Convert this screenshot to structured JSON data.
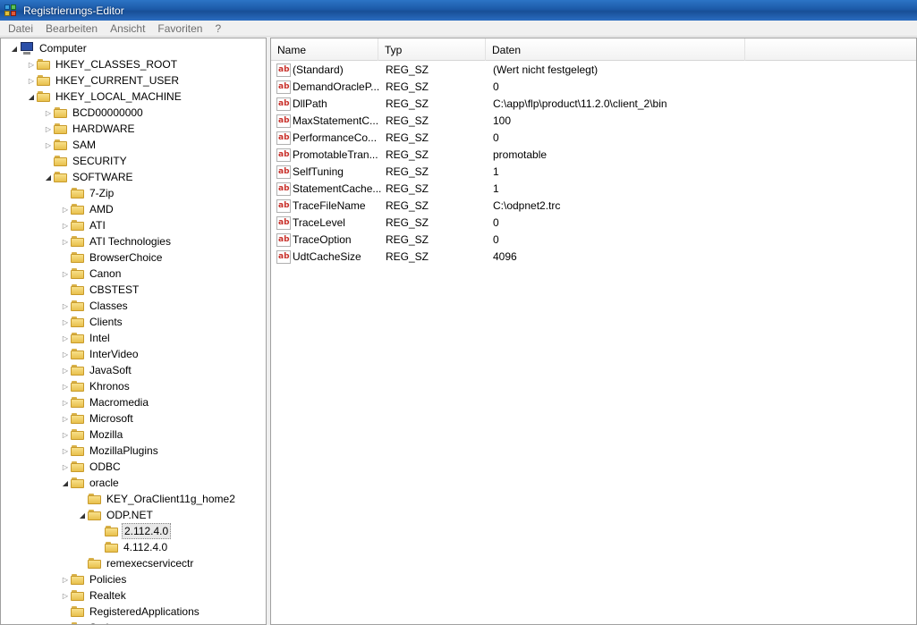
{
  "window": {
    "title": "Registrierungs-Editor"
  },
  "menu": [
    "Datei",
    "Bearbeiten",
    "Ansicht",
    "Favoriten",
    "?"
  ],
  "tree": [
    {
      "label": "Computer",
      "level": 0,
      "state": "open",
      "icon": "computer-icon"
    },
    {
      "label": "HKEY_CLASSES_ROOT",
      "level": 1,
      "state": "closed"
    },
    {
      "label": "HKEY_CURRENT_USER",
      "level": 1,
      "state": "closed"
    },
    {
      "label": "HKEY_LOCAL_MACHINE",
      "level": 1,
      "state": "open"
    },
    {
      "label": "BCD00000000",
      "level": 2,
      "state": "closed"
    },
    {
      "label": "HARDWARE",
      "level": 2,
      "state": "closed"
    },
    {
      "label": "SAM",
      "level": 2,
      "state": "closed"
    },
    {
      "label": "SECURITY",
      "level": 2,
      "state": "none"
    },
    {
      "label": "SOFTWARE",
      "level": 2,
      "state": "open"
    },
    {
      "label": "7-Zip",
      "level": 3,
      "state": "none"
    },
    {
      "label": "AMD",
      "level": 3,
      "state": "closed"
    },
    {
      "label": "ATI",
      "level": 3,
      "state": "closed"
    },
    {
      "label": "ATI Technologies",
      "level": 3,
      "state": "closed"
    },
    {
      "label": "BrowserChoice",
      "level": 3,
      "state": "none"
    },
    {
      "label": "Canon",
      "level": 3,
      "state": "closed"
    },
    {
      "label": "CBSTEST",
      "level": 3,
      "state": "none"
    },
    {
      "label": "Classes",
      "level": 3,
      "state": "closed"
    },
    {
      "label": "Clients",
      "level": 3,
      "state": "closed"
    },
    {
      "label": "Intel",
      "level": 3,
      "state": "closed"
    },
    {
      "label": "InterVideo",
      "level": 3,
      "state": "closed"
    },
    {
      "label": "JavaSoft",
      "level": 3,
      "state": "closed"
    },
    {
      "label": "Khronos",
      "level": 3,
      "state": "closed"
    },
    {
      "label": "Macromedia",
      "level": 3,
      "state": "closed"
    },
    {
      "label": "Microsoft",
      "level": 3,
      "state": "closed"
    },
    {
      "label": "Mozilla",
      "level": 3,
      "state": "closed"
    },
    {
      "label": "MozillaPlugins",
      "level": 3,
      "state": "closed"
    },
    {
      "label": "ODBC",
      "level": 3,
      "state": "closed"
    },
    {
      "label": "oracle",
      "level": 3,
      "state": "open"
    },
    {
      "label": "KEY_OraClient11g_home2",
      "level": 4,
      "state": "none"
    },
    {
      "label": "ODP.NET",
      "level": 4,
      "state": "open"
    },
    {
      "label": "2.112.4.0",
      "level": 5,
      "state": "none",
      "selected": true
    },
    {
      "label": "4.112.4.0",
      "level": 5,
      "state": "none"
    },
    {
      "label": "remexecservicectr",
      "level": 4,
      "state": "none"
    },
    {
      "label": "Policies",
      "level": 3,
      "state": "closed"
    },
    {
      "label": "Realtek",
      "level": 3,
      "state": "closed"
    },
    {
      "label": "RegisteredApplications",
      "level": 3,
      "state": "none"
    },
    {
      "label": "Serious",
      "level": 3,
      "state": "closed"
    }
  ],
  "columns": [
    "Name",
    "Typ",
    "Daten"
  ],
  "values": [
    {
      "name": "(Standard)",
      "type": "REG_SZ",
      "data": "(Wert nicht festgelegt)"
    },
    {
      "name": "DemandOracleP...",
      "type": "REG_SZ",
      "data": "0"
    },
    {
      "name": "DllPath",
      "type": "REG_SZ",
      "data": "C:\\app\\flp\\product\\11.2.0\\client_2\\bin"
    },
    {
      "name": "MaxStatementC...",
      "type": "REG_SZ",
      "data": "100"
    },
    {
      "name": "PerformanceCo...",
      "type": "REG_SZ",
      "data": "0"
    },
    {
      "name": "PromotableTran...",
      "type": "REG_SZ",
      "data": "promotable"
    },
    {
      "name": "SelfTuning",
      "type": "REG_SZ",
      "data": "1"
    },
    {
      "name": "StatementCache...",
      "type": "REG_SZ",
      "data": "1"
    },
    {
      "name": "TraceFileName",
      "type": "REG_SZ",
      "data": "C:\\odpnet2.trc"
    },
    {
      "name": "TraceLevel",
      "type": "REG_SZ",
      "data": "0"
    },
    {
      "name": "TraceOption",
      "type": "REG_SZ",
      "data": "0"
    },
    {
      "name": "UdtCacheSize",
      "type": "REG_SZ",
      "data": "4096"
    }
  ],
  "value_icon_text": "ab"
}
